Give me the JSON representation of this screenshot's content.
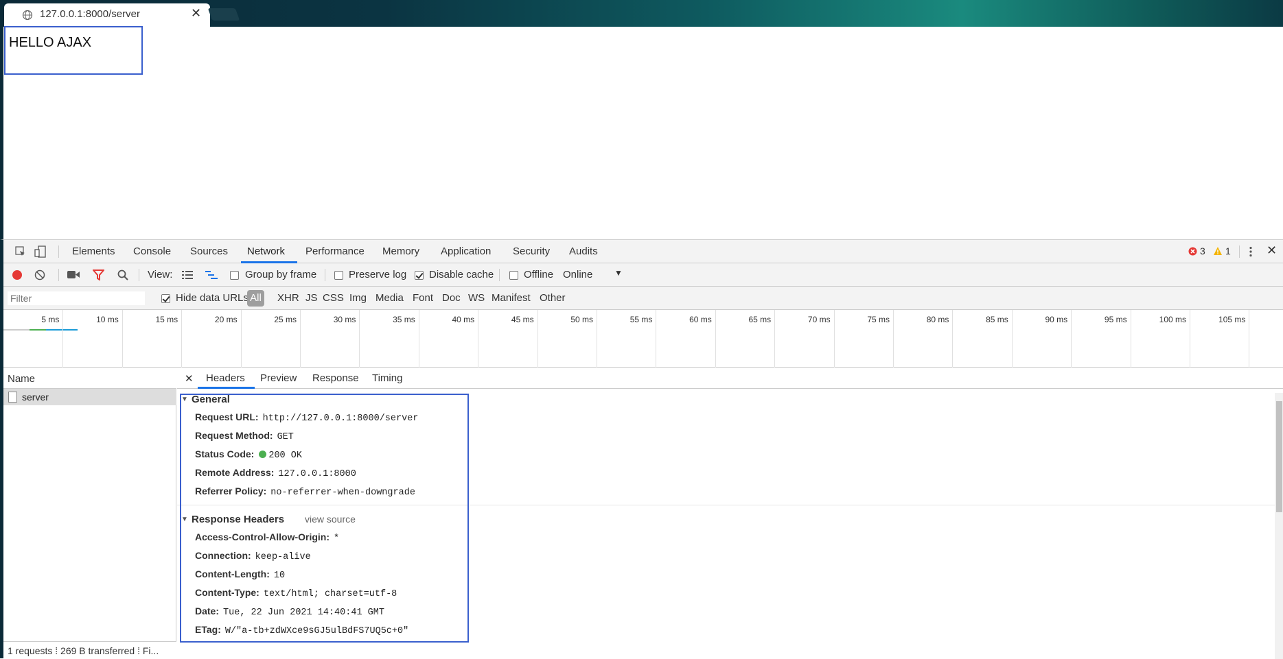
{
  "browser": {
    "tab_title": "127.0.0.1:8000/server",
    "tab_close": "✕"
  },
  "page": {
    "content_text": "HELLO AJAX"
  },
  "devtools": {
    "main_tabs": [
      "Elements",
      "Console",
      "Sources",
      "Network",
      "Performance",
      "Memory",
      "Application",
      "Security",
      "Audits"
    ],
    "active_tab": "Network",
    "errors_count": "3",
    "warnings_count": "1",
    "toolbar": {
      "view_label": "View:",
      "group_by_frame": "Group by frame",
      "preserve_log": "Preserve log",
      "disable_cache": "Disable cache",
      "offline": "Offline",
      "throttling": "Online"
    },
    "filterbar": {
      "filter_placeholder": "Filter",
      "hide_data_urls": "Hide data URLs",
      "types": [
        "All",
        "XHR",
        "JS",
        "CSS",
        "Img",
        "Media",
        "Font",
        "Doc",
        "WS",
        "Manifest",
        "Other"
      ]
    },
    "overview_ticks": [
      "5 ms",
      "10 ms",
      "15 ms",
      "20 ms",
      "25 ms",
      "30 ms",
      "35 ms",
      "40 ms",
      "45 ms",
      "50 ms",
      "55 ms",
      "60 ms",
      "65 ms",
      "70 ms",
      "75 ms",
      "80 ms",
      "85 ms",
      "90 ms",
      "95 ms",
      "100 ms",
      "105 ms"
    ],
    "request_list": {
      "header": "Name",
      "rows": [
        "server"
      ],
      "status": "1 requests  ⁞  269 B transferred  ⁞  Fi..."
    },
    "detail": {
      "close": "✕",
      "tabs": [
        "Headers",
        "Preview",
        "Response",
        "Timing"
      ],
      "active_tab": "Headers",
      "general_title": "General",
      "general": [
        {
          "key": "Request URL:",
          "value": "http://127.0.0.1:8000/server"
        },
        {
          "key": "Request Method:",
          "value": "GET"
        },
        {
          "key": "Status Code:",
          "value": "200 OK"
        },
        {
          "key": "Remote Address:",
          "value": "127.0.0.1:8000"
        },
        {
          "key": "Referrer Policy:",
          "value": "no-referrer-when-downgrade"
        }
      ],
      "response_title": "Response Headers",
      "view_source": "view source",
      "response": [
        {
          "key": "Access-Control-Allow-Origin:",
          "value": "*"
        },
        {
          "key": "Connection:",
          "value": "keep-alive"
        },
        {
          "key": "Content-Length:",
          "value": "10"
        },
        {
          "key": "Content-Type:",
          "value": "text/html; charset=utf-8"
        },
        {
          "key": "Date:",
          "value": "Tue, 22 Jun 2021 14:40:41 GMT"
        },
        {
          "key": "ETag:",
          "value": "W/\"a-tb+zdWXce9sGJ5ulBdFS7UQ5c+0\""
        }
      ]
    },
    "colors": {
      "accent": "#1a73e8",
      "highlight_box": "#3a5fcd",
      "record": "#e53935",
      "status_ok": "#4caf50"
    }
  }
}
